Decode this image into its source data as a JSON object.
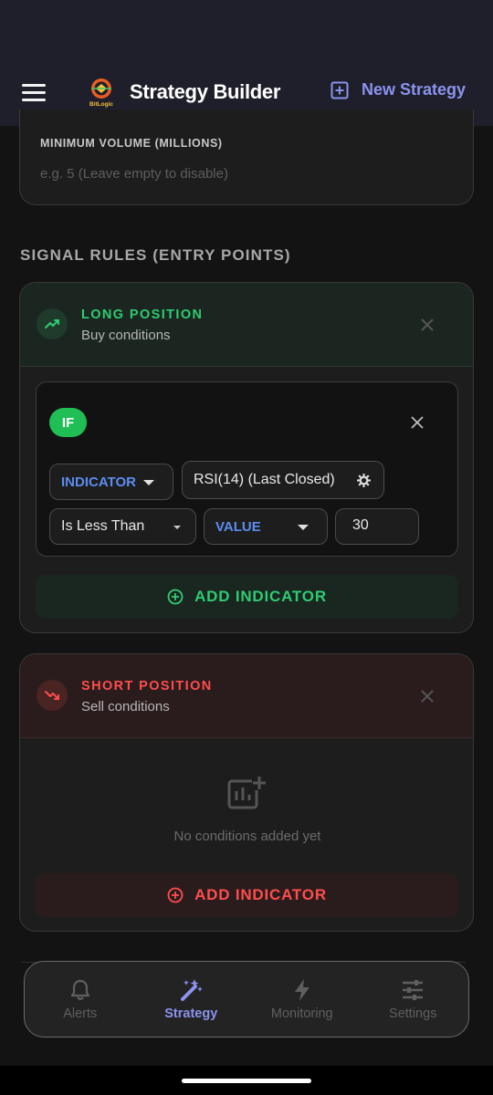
{
  "header": {
    "title": "Strategy Builder",
    "logo_text": "BitLogic",
    "new_strategy_label": "New Strategy"
  },
  "volume": {
    "label": "MINIMUM VOLUME (MILLIONS)",
    "placeholder": "e.g. 5 (Leave empty to disable)"
  },
  "signals": {
    "section_title": "SIGNAL RULES (ENTRY POINTS)",
    "long": {
      "title": "LONG POSITION",
      "subtitle": "Buy conditions",
      "rule": {
        "if_label": "IF",
        "left_type": "INDICATOR",
        "indicator": "RSI(14) (Last Closed)",
        "operator": "Is Less Than",
        "right_type": "VALUE",
        "value": "30"
      },
      "add_label": "ADD INDICATOR"
    },
    "short": {
      "title": "SHORT POSITION",
      "subtitle": "Sell conditions",
      "empty_text": "No conditions added yet",
      "add_label": "ADD INDICATOR"
    }
  },
  "nav": {
    "items": [
      {
        "label": "Alerts",
        "icon": "bell-icon"
      },
      {
        "label": "Strategy",
        "icon": "magic-wand-icon",
        "active": true
      },
      {
        "label": "Monitoring",
        "icon": "lightning-icon"
      },
      {
        "label": "Settings",
        "icon": "sliders-icon"
      }
    ]
  },
  "colors": {
    "accent": "#8c93ee",
    "long": "#2ecc71",
    "short": "#ff4d4d",
    "indicator_blue": "#5c8cf0"
  }
}
